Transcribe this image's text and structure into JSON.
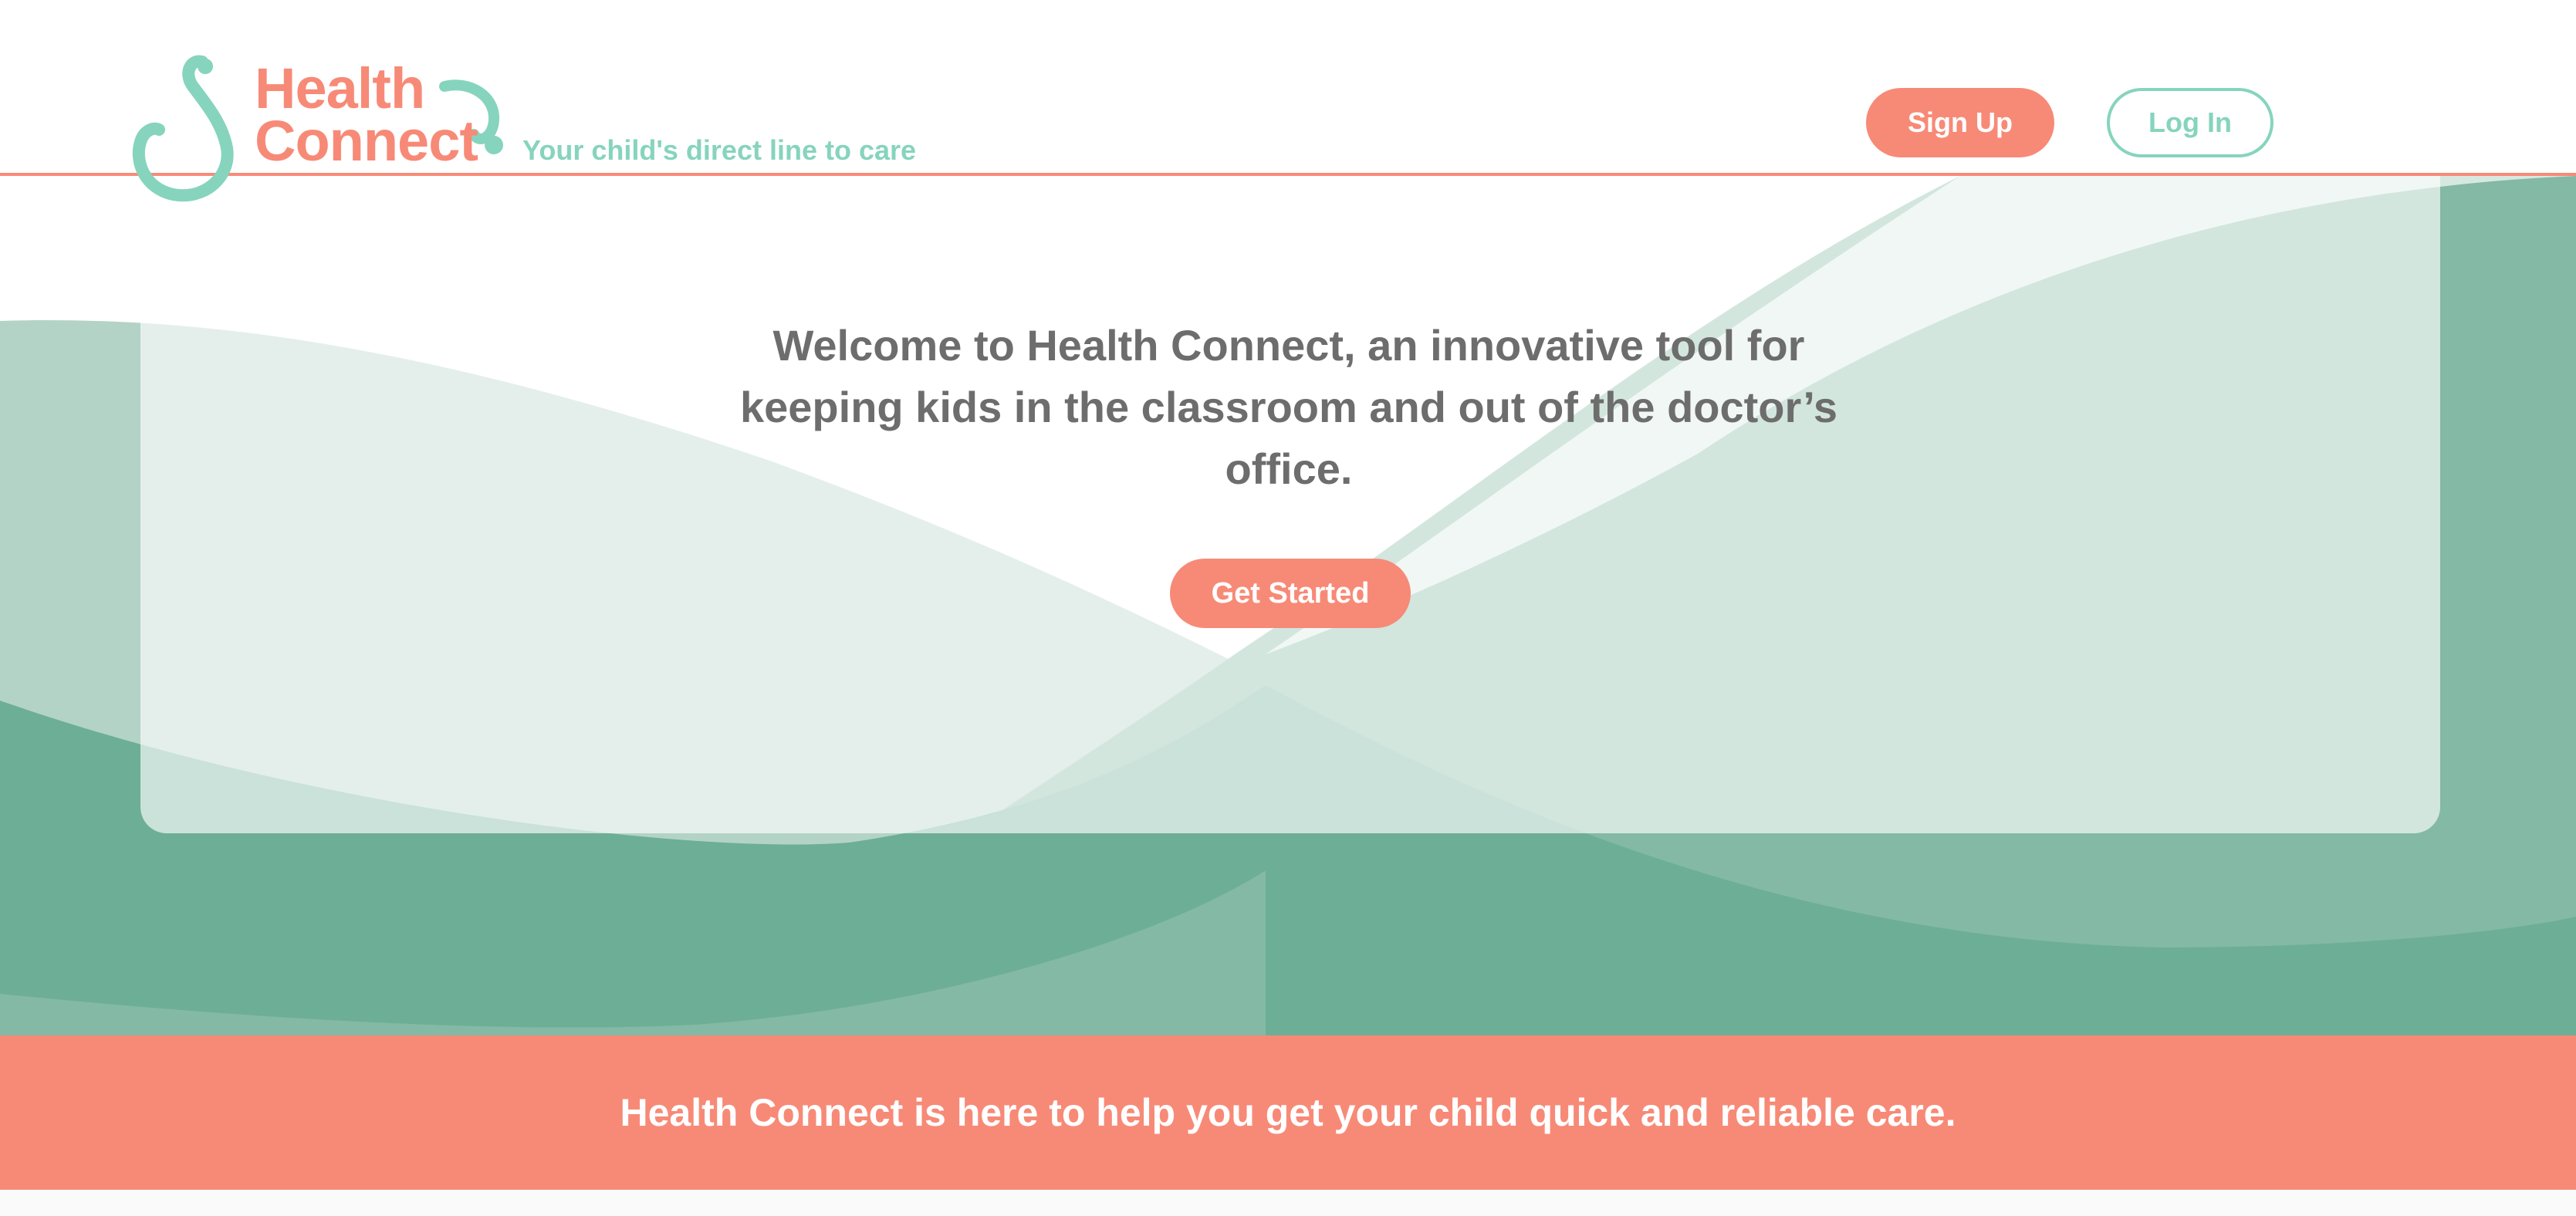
{
  "brand": {
    "name_line1": "Health",
    "name_line2": "Connect",
    "tagline": "Your child's direct line to care",
    "logo_icon": "stethoscope-icon"
  },
  "header": {
    "signup_label": "Sign Up",
    "login_label": "Log In"
  },
  "hero": {
    "heading": "Welcome to Health Connect, an innovative tool for keeping kids in the classroom and out of the doctor’s office.",
    "cta_label": "Get Started"
  },
  "banner": {
    "text": "Health Connect is here to help you get your child quick and reliable care."
  },
  "colors": {
    "accent_coral": "#f78a77",
    "accent_mint": "#86d4bd",
    "wave_green_dark": "#6dae96",
    "wave_green_mid": "#83b9a5",
    "wave_green_light": "#aed1c4",
    "heading_gray": "#6d6d6d"
  }
}
